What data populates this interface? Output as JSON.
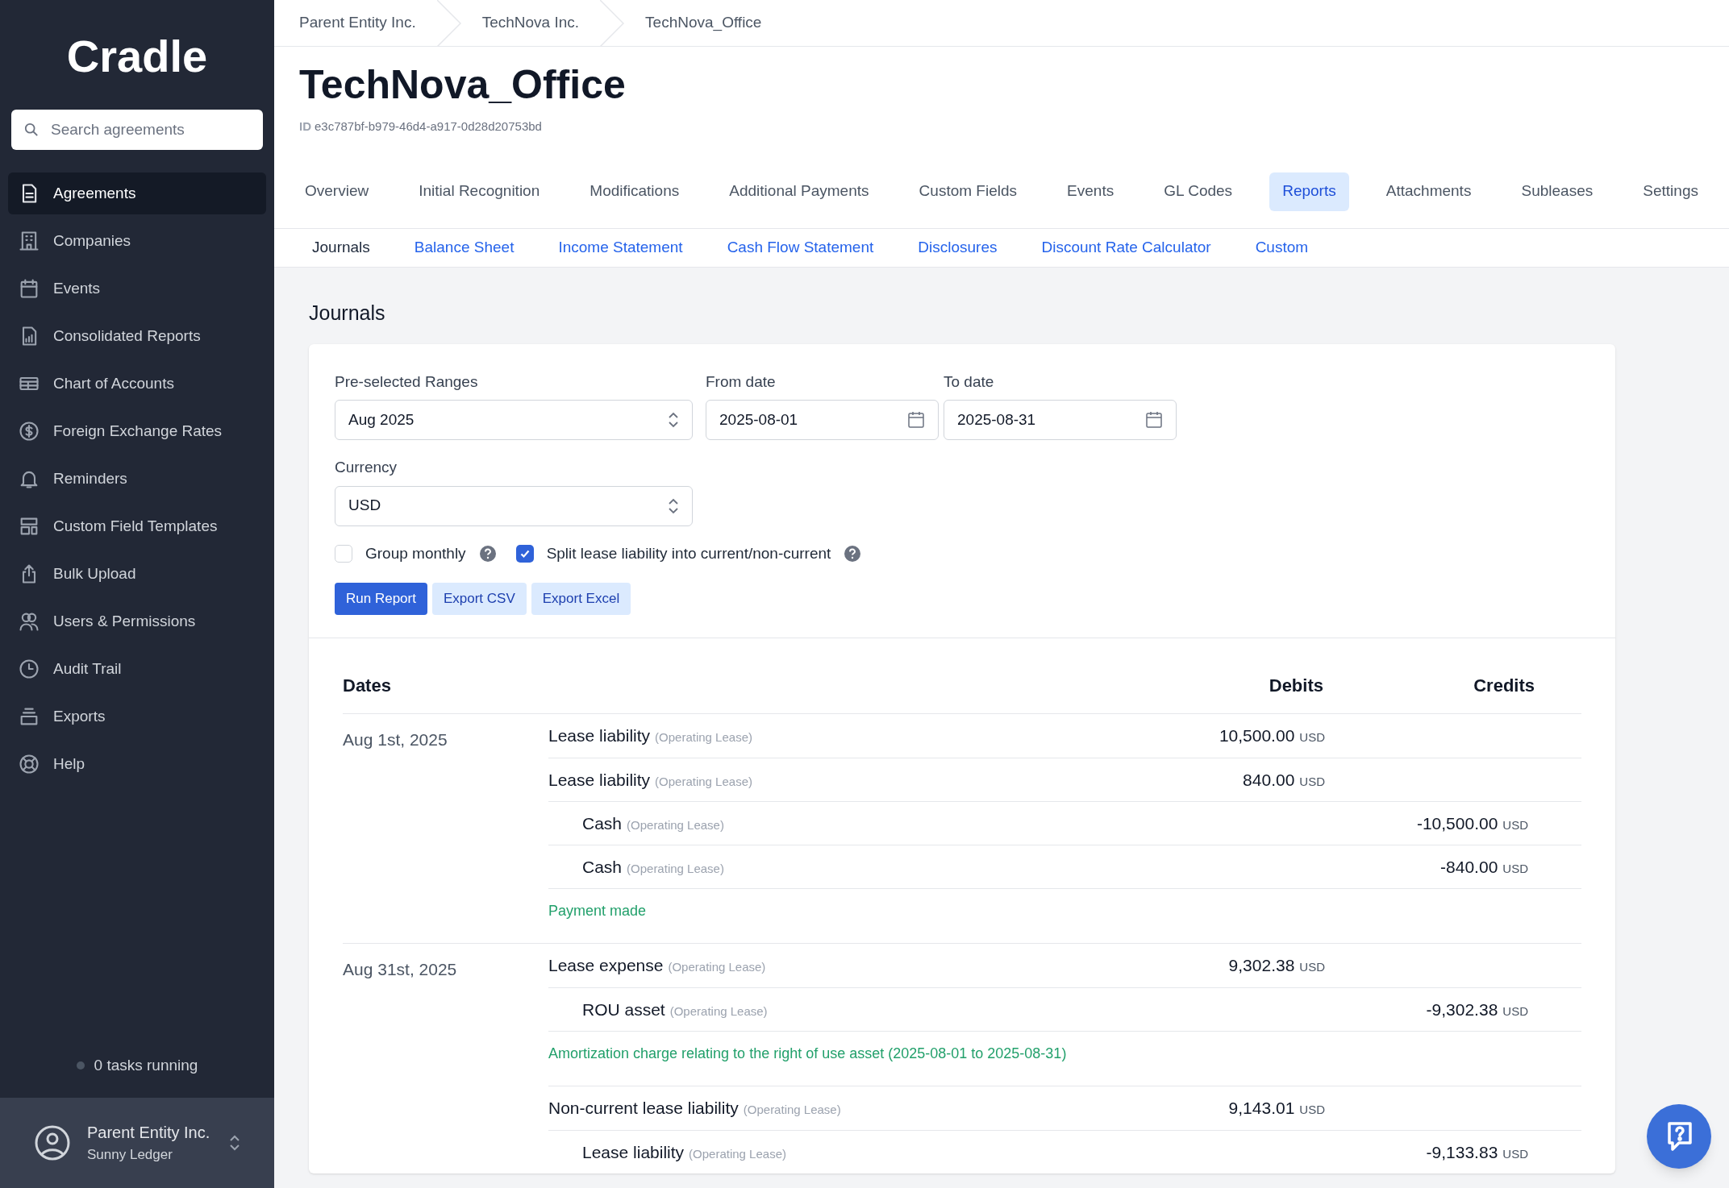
{
  "sidebar": {
    "logo": "Cradle",
    "search": {
      "placeholder": "Search agreements"
    },
    "items": [
      {
        "label": "Agreements",
        "selected": true
      },
      {
        "label": "Companies",
        "selected": false
      },
      {
        "label": "Events",
        "selected": false
      },
      {
        "label": "Consolidated Reports",
        "selected": false
      },
      {
        "label": "Chart of Accounts",
        "selected": false
      },
      {
        "label": "Foreign Exchange Rates",
        "selected": false
      },
      {
        "label": "Reminders",
        "selected": false
      },
      {
        "label": "Custom Field Templates",
        "selected": false
      },
      {
        "label": "Bulk Upload",
        "selected": false
      },
      {
        "label": "Users & Permissions",
        "selected": false
      },
      {
        "label": "Audit Trail",
        "selected": false
      },
      {
        "label": "Exports",
        "selected": false
      },
      {
        "label": "Help",
        "selected": false
      }
    ],
    "tasks_status": "0 tasks running",
    "account": {
      "name": "Parent Entity Inc.",
      "subtitle": "Sunny Ledger"
    }
  },
  "breadcrumbs": [
    "Parent Entity Inc.",
    "TechNova Inc.",
    "TechNova_Office"
  ],
  "title": "TechNova_Office",
  "id_label": "ID",
  "id_value": "e3c787bf-b979-46d4-a917-0d28d20753bd",
  "tabs": [
    {
      "label": "Overview",
      "selected": false
    },
    {
      "label": "Initial Recognition",
      "selected": false
    },
    {
      "label": "Modifications",
      "selected": false
    },
    {
      "label": "Additional Payments",
      "selected": false
    },
    {
      "label": "Custom Fields",
      "selected": false
    },
    {
      "label": "Events",
      "selected": false
    },
    {
      "label": "GL Codes",
      "selected": false
    },
    {
      "label": "Reports",
      "selected": true
    },
    {
      "label": "Attachments",
      "selected": false
    },
    {
      "label": "Subleases",
      "selected": false
    },
    {
      "label": "Settings",
      "selected": false
    }
  ],
  "subtabs": [
    {
      "label": "Journals",
      "selected": true
    },
    {
      "label": "Balance Sheet",
      "selected": false
    },
    {
      "label": "Income Statement",
      "selected": false
    },
    {
      "label": "Cash Flow Statement",
      "selected": false
    },
    {
      "label": "Disclosures",
      "selected": false
    },
    {
      "label": "Discount Rate Calculator",
      "selected": false
    },
    {
      "label": "Custom",
      "selected": false
    }
  ],
  "section_title": "Journals",
  "form": {
    "range": {
      "label": "Pre-selected Ranges",
      "value": "Aug 2025"
    },
    "from_date": {
      "label": "From date",
      "value": "2025-08-01"
    },
    "to_date": {
      "label": "To date",
      "value": "2025-08-31"
    },
    "currency": {
      "label": "Currency",
      "value": "USD"
    },
    "options": [
      {
        "label": "Group monthly",
        "checked": false
      },
      {
        "label": "Split lease liability into current/non-current",
        "checked": true
      }
    ],
    "buttons": [
      {
        "label": "Run Report",
        "kind": "primary"
      },
      {
        "label": "Export CSV",
        "kind": "secondary"
      },
      {
        "label": "Export Excel",
        "kind": "secondary"
      }
    ]
  },
  "table": {
    "columns": [
      "Dates",
      "Debits",
      "Credits"
    ],
    "groups": [
      {
        "date": "Aug 1st, 2025",
        "lines": [
          {
            "account": "Lease liability",
            "qualifier": "(Operating Lease)",
            "kind": "debit",
            "amount": "10,500.00",
            "currency": "USD"
          },
          {
            "account": "Lease liability",
            "qualifier": "(Operating Lease)",
            "kind": "debit",
            "amount": "840.00",
            "currency": "USD"
          },
          {
            "account": "Cash",
            "qualifier": "(Operating Lease)",
            "kind": "credit",
            "amount": "-10,500.00",
            "currency": "USD"
          },
          {
            "account": "Cash",
            "qualifier": "(Operating Lease)",
            "kind": "credit",
            "amount": "-840.00",
            "currency": "USD"
          }
        ],
        "note": "Payment made"
      },
      {
        "date": "Aug 31st, 2025",
        "lines": [
          {
            "account": "Lease expense",
            "qualifier": "(Operating Lease)",
            "kind": "debit",
            "amount": "9,302.38",
            "currency": "USD"
          },
          {
            "account": "ROU asset",
            "qualifier": "(Operating Lease)",
            "kind": "credit",
            "amount": "-9,302.38",
            "currency": "USD"
          }
        ],
        "note": "Amortization charge relating to the right of use asset (2025-08-01 to 2025-08-31)"
      },
      {
        "lines": [
          {
            "account": "Non-current lease liability",
            "qualifier": "(Operating Lease)",
            "kind": "debit",
            "amount": "9,143.01",
            "currency": "USD"
          },
          {
            "account": "Lease liability",
            "qualifier": "(Operating Lease)",
            "kind": "credit",
            "amount": "-9,133.83",
            "currency": "USD"
          }
        ]
      }
    ]
  }
}
